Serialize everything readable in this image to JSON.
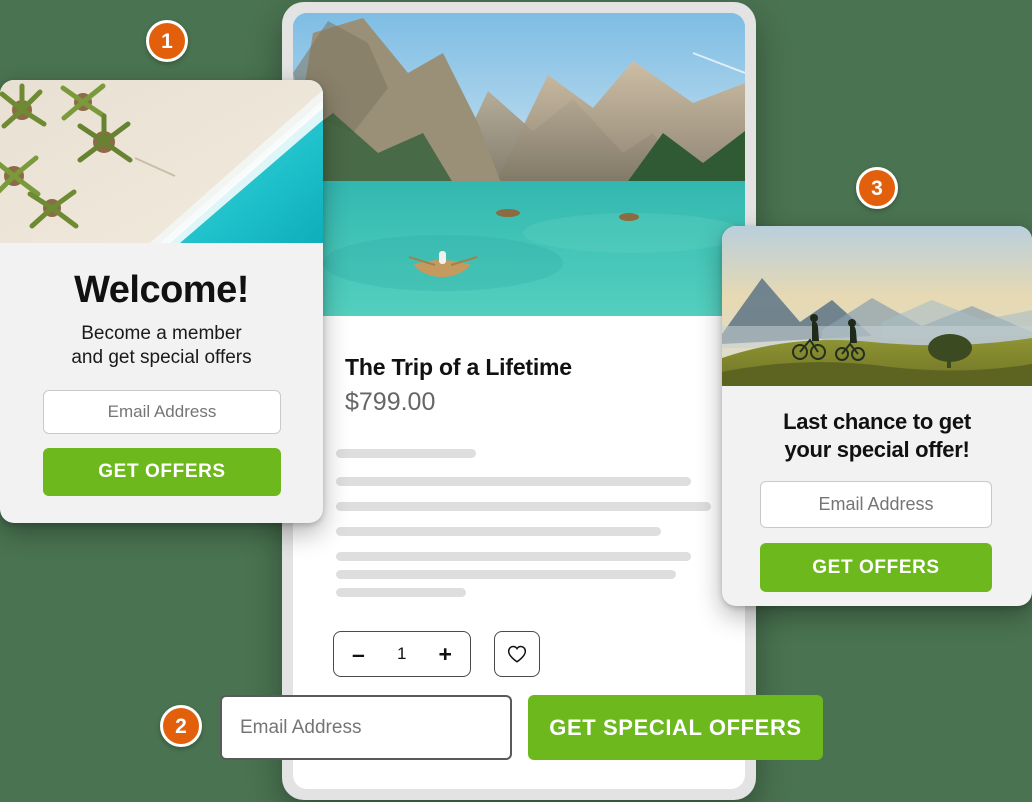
{
  "background_color": "#4a7351",
  "accent_green": "#6cb81d",
  "badge_color": "#e2600c",
  "badges": [
    {
      "number": "1"
    },
    {
      "number": "2"
    },
    {
      "number": "3"
    }
  ],
  "card_welcome": {
    "hero_icon": "beach-aerial-photo",
    "title": "Welcome!",
    "subtitle_line1": "Become a member",
    "subtitle_line2": "and get special offers",
    "email_placeholder": "Email Address",
    "email_value": "",
    "button_label": "GET OFFERS"
  },
  "card_product": {
    "hero_icon": "mountain-lake-photo",
    "title": "The Trip of a Lifetime",
    "price": "$799.00",
    "skeleton_widths": [
      140,
      355,
      375,
      325,
      355,
      340,
      130
    ],
    "quantity": {
      "decrement_label": "–",
      "value": "1",
      "increment_label": "+"
    },
    "wishlist_icon": "heart-icon",
    "bottom_bar": {
      "email_placeholder": "Email Address",
      "email_value": "",
      "button_label": "GET SPECIAL OFFERS"
    }
  },
  "card_last_chance": {
    "hero_icon": "mountain-bikers-sunrise-photo",
    "title_line1": "Last chance to get",
    "title_line2": "your special offer!",
    "email_placeholder": "Email Address",
    "email_value": "",
    "button_label": "GET OFFERS"
  }
}
